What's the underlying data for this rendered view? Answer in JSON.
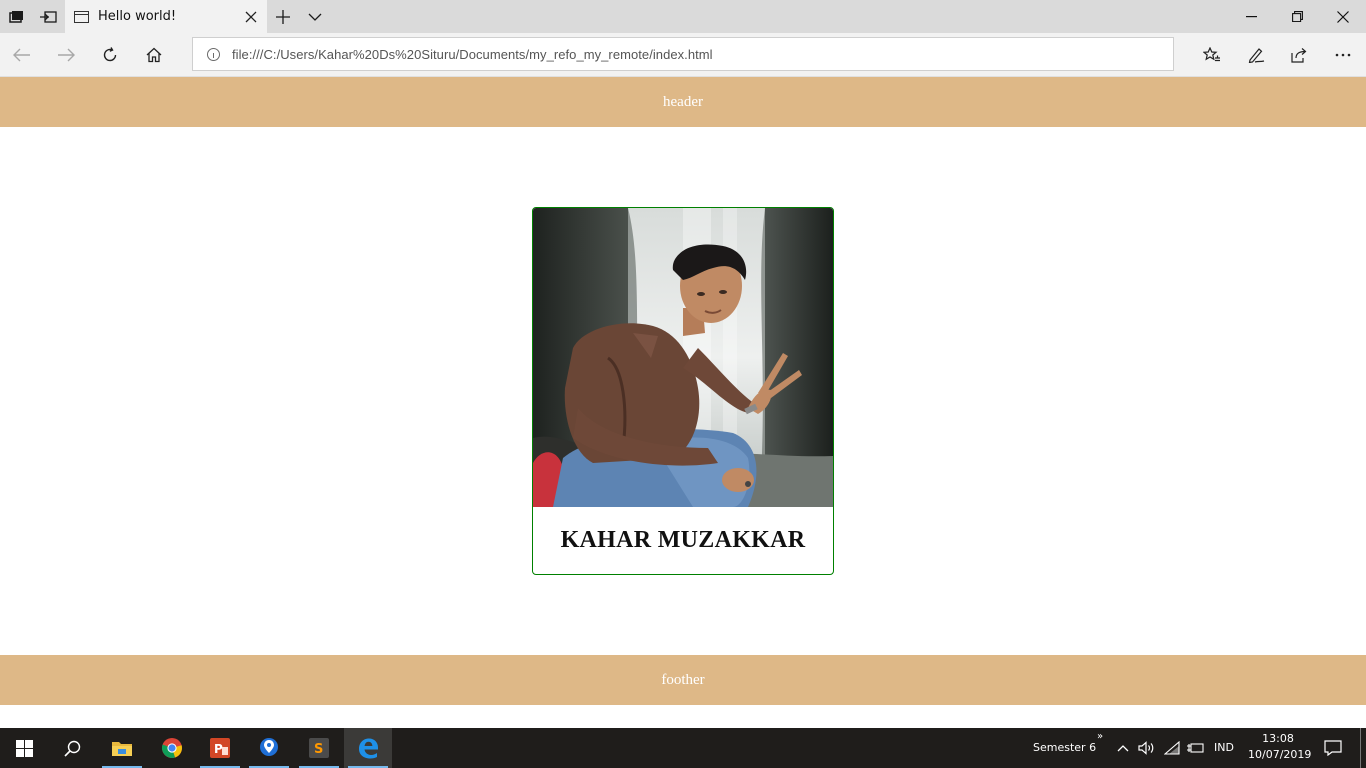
{
  "browser": {
    "tab_title": "Hello world!",
    "address": "file:///C:/Users/Kahar%20Ds%20Situru/Documents/my_refo_my_remote/index.html"
  },
  "page": {
    "header_text": "header",
    "footer_text": "foother",
    "card": {
      "name": "KAHAR MUZAKKAR",
      "border_color": "#008000"
    },
    "band_color": "#deb887"
  },
  "taskbar": {
    "pinned_apps": [
      "file-explorer",
      "chrome",
      "powerpoint",
      "maps",
      "sublime-text",
      "edge"
    ],
    "toolbar_label": "Semester 6",
    "language": "IND",
    "time": "13:08",
    "date": "10/07/2019"
  }
}
